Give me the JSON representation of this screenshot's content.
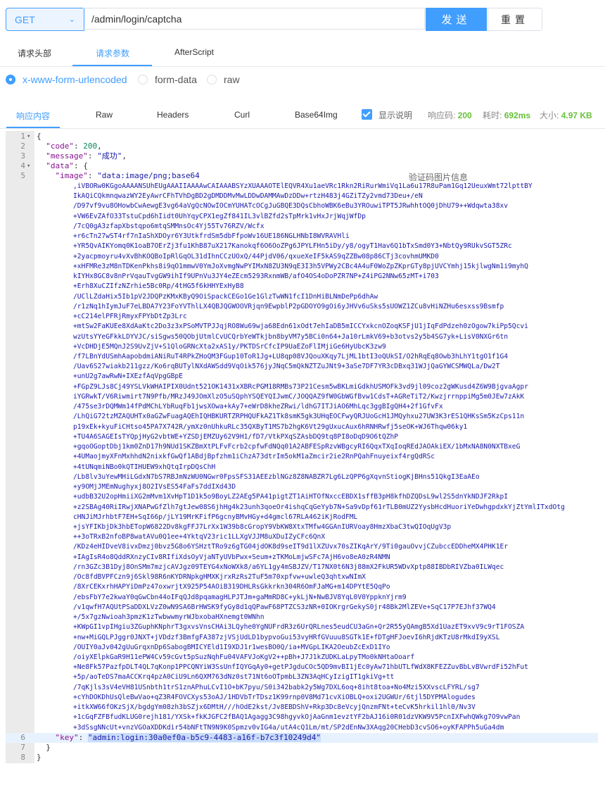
{
  "request": {
    "method": "GET",
    "url": "/admin/login/captcha",
    "send_label": "发送",
    "reset_label": "重置"
  },
  "request_tabs": [
    "请求头部",
    "请求参数",
    "AfterScript"
  ],
  "body_types": [
    "x-www-form-urlencoded",
    "form-data",
    "raw"
  ],
  "response_tabs": [
    "响应内容",
    "Raw",
    "Headers",
    "Curl",
    "Base64Img"
  ],
  "response_meta": {
    "show_desc_label": "显示说明",
    "code_label": "响应码:",
    "code_value": "200",
    "time_label": "耗时:",
    "time_value": "692ms",
    "size_label": "大小:",
    "size_value": "4.97 KB"
  },
  "code": {
    "line_numbers": [
      "1",
      "2",
      "3",
      "4",
      "5",
      "6",
      "7",
      "8"
    ],
    "open_brace": "{",
    "code_key": "\"code\"",
    "code_value": "200",
    "message_key": "\"message\"",
    "message_value": "\"成功\"",
    "data_key": "\"data\"",
    "image_key": "\"image\"",
    "image_value_start": "\"data:image/png;base64",
    "image_tooltip": "验证码图片信息",
    "key_key": "\"key\"",
    "key_value": "\"admin:login:30a0ef0a-b5c9-4483-a16f-b7c3f10249d4\"",
    "close_data": "}",
    "close_root": "}",
    "image_lines": [
      ",iVBORw0KGgoAAAANSUhEUgAAAIIAAAAwCAIAAABSYzXUAAAOTElEQVR4Xu1aeVRc1Rkn2RiRurWmiVq1La6u17R8uPam1Gq12UeuxWmt72lpttBY",
      "IkAQiCQkmnqwazWY2EyAwrCFhTVhDgBD2gDMDDMvMwLDDwDAMMAwDzDDw+rtzH483j4GZiTZy2vmd73Deu+/eN",
      "/D97vf9vu8OHowbCwAewgE3vg64aVgQcNOwIOCmYUHATcOCgJuGBQE3DQsCbhoWBK6eBu3YROuwiTPT5JRwhhtOQ0jDhU79++Wdqwta38xv",
      "+VW6EvZAfO33TstuCpd6hIidt0UhYqyCPX1egZf841IL3vlBZfd2sTpMrk1vHxJrjWqjWfDp",
      "/7cQ0gA3zfapXbstqpo6mtqSMMnsOc4Yj55Tv76RZV/Wcfx",
      "+r6cTn27wST4rf7nIaShXDOyr6Y3UtkfrdSm5dbFfpoWv16UE186NGLHNbI8WVRAVHli",
      "+YR5QvAIKYomq0K1oaB7OErZj3fu1KhB87uX217Kanokqf6O6OoZPg6JPYLFHn5iDy/y8/ogyT1Hav6Q1bTxSmd0Y3+NbtQy9RUkvSGT5ZRc",
      "+2yacpmoyru4vXvBhKOQBoIpRlGqOL31dIhnCCzUOxQ/44PjdV06/qxueXeIF5kAS9qZZBw08p86CTj3covhmUMKD0",
      "+xHFMRe3zM8nTDKenPkhs8i9qO1mmwV0YmJoXvmgNwPYIMxN8ZU3N9qE3I3h5VPWy2CBc4A4uF0WoZpZKprGTy8pjUVCYmhj15kjlwgNm1i9myhQ",
      "kIYHx8GC8v8nPrVqauTvgGW9ihIf9UPnVu3JY4eZEcm5293RxnmWB/afO4OS4oDoPZR7NP+Z4iPG2NNw65zMT+i703",
      "+Erh8XuCZIfzNZrhie5Bc0Rp/4tHG5f6kHHYExHyB8",
      "/UClLZdaHix5Ib1pV2JDQPzKMxKByQ9OiSpackCEGo1Ge1GlzTwWN1fcI1DnHiBLNmDePp6dhAw",
      "/r1zNq1hIymJuF7eLBDA7Y23FoYVThlLX4QBJQGWOOVRjqn9EwpblP2pGDOYO9gOi6yJHVv6uSks5sUOWZ1ZCu8vHiNZHu6esxss9Bsmfp",
      "+cC214elPFRjRmyxFPYbDtZp3Lrc",
      "+mtSw2FaKUEe8XdAaKtc2Do3z3xPSoMVTPJJqjRO8Wu69wja68Edn61xOdt7ehIaDB5mICCYxkcnOZoqKSFjU1jIqFdPdzeh0zOgow7kiPp5Qcvi",
      "wzUtsYYeGFkkLDYVJC/siSgws50QObjUtmlCvUCQrbYeWTkjbn8byVM7y5BCi0n64+Ja10rLmkV69+b3otvs2y5b4SG7yk+LisV0NXGr6tn",
      "+VcDHDjE5MQnJ2S9UvZjV+S1QloGRNcXta2xAS1y/PKTDSrCfcIP9UaEZoFlIMjiGe6HyUbcK3zw9",
      "/f7LBnYdUSmhAapobdmiANiRuT4RPkZHoQM3FGup10ToR1Jg+LU8qp08VJQouXKqy7LjML1btI3oQUkSI/O2hRqEq8Owb3hLhY1tgO1f1G4",
      "/Uav6S27wiakb211gzz/Ko6rqBUTylNXdAWSdd9VqOik576jyJNqC5mQkNZTZuJNt9+3aSe7DF7YR3cDBxq31WJjQaGYWCSMWQLa/Dw2T",
      "+unU2g7awRwN+IXEzfAqVpgGBpE",
      "+FGpZ9LJs8Cj49YSLVkWHAIPIX0Udnt521OK1431xXBRcPGM18RMBs73P21Cesm5wBKLmiGdkhUSMOFk3vd9jl09coz2gWKusd4Z6W9BjgvaAgpr",
      "iYGRwkT/V6Riwmirt7N9Pfb/MRzJ49JOmXlzO5uSQphYSQEYQIJwmC/JOQQAZ9fW0GbWGfBvw1CdsT+AGReTiT2/KwzjrrnppiMg5m0JEw7zAkK",
      "/475se3rDQMWm14fPdMChLYbRuqFb1jwsXOwa+kAy7+eWrD8kheZRwi/ldhG7ITJiAO6MhLqc3ggBIgQH4+2f1GfvFx",
      "/LhQiG72tzMZAQUHTx0aGZwFuagAQEhIQHBKURTZRPHQUFkAZ1Tk8smK5gk3UHqEOCFwyQRJUoGcH1JMQyhxu27UW3K3rES1QHKsSm5KzCps11n",
      "p19xEk+kyuFiCHtso45PA7X742R/ymXz0nUhkuRLc35QXByT1MS7b2hgK6Vt29gUxucAux6hRNHRwfj5seOK+WJ6Thqw06ky1",
      "+TU4A6SAGEIsTYQpjHyG2vbtWE+YZSDjEMZUy62V9H1/fD7/VtkPXqSZAsbDQ9tq8PI8oDqD9O6tQZhP",
      "+gqoOGoptDbj1km0ZnD17h9NUd1SKZBmXtPLFvFcrb2cpfwFdNQq01A2ABFESpRzvWBgcyRI6QqxTXqIoqREdJAOAkiEX/1bMxNA8N0NXTBxeG",
      "+4UMaojmyXFnMxhhdN2nixkfGwQf1ABdjBpfzhm1iChzA73dtrIm5okM1aZmcir2ie2RnPQahFnuyeixf4rgQdRSc",
      "+4tUNqmiNBo0kQTIHUEW9xhQtqIrpDQsChH",
      "/Lb8lv3uYewMHiLGdxN7bS7RBJmNzWU0NGwr0FpsSFS31AEEzblNGz8Z8NABZR7Lg6LzQPP6gXqvnStiogKjBHns51QkgI3EaAEo",
      "+y9OMjJMEmNughyxj8O2IVsES54FaFs7ddIXd43D",
      "+udbB32U2opHmiiXG2mMvm1XvHpT1D1k5o9BoyLZ2AEg5PA41pigtZT1AiHTOfNxccEBDX1sffB3pH8kfhDZQDsL9wl2S5dnYkNDJF2RkpI",
      "+z2SBAg40RiIRwjXNAPwGfZlh7gtJew08S6jhHg4k23unh3qoeOr4ishqCqGeYyb7N+Sa9vDpf61rTLB0mUZ2YysbHcdHuoriYeDwhgpdxkYjZtYmlITxdOtg",
      "cHNJiMJrhbtF7EH+SqI66p/jLY19MrKFifP6gcnyBMvHGy+d4gmcl67RLA462iKjRodFML",
      "+jsYFIKbjDk3hbETopW6822Dv8kgFFJ7LrXx1W39b8cGropY9VbKW8XtxTMfw4GGAnIURVoay8HmzXbaC3twQIOqUgV3p",
      "++3oTRxB2nfoBP8watAVu0Q1ee+4YktqV23ric1LLXgVJJM8uXDuIZyCFc6QnX",
      "/KDz4eHIDveV8ivxDmzj0bvz5G8o6YSHztTRo9z6gTG04jdOK8d9seIT9d1lXZUvx70sZIKqArY/9Ti0gauOvvjCZubccEDDheMX4PHK1Er",
      "+IAgIsR4o8QddRXnzyCIv8RIfiXdsOyVjaNTyUVbPwx+Seum+zTKMoLmjwSFc7AjH6vo8eA0zR4NMN",
      "/rn3GZc3B1Dyj8OnSMm7mzjcAVJgz09TEYG4xNoWXk8/a6YL1gy4mSBJZV/T17NX0t6N3j88mX2FkUR5WDvXptp88IBDbRIVZba0ILWqec",
      "/Oc8fdBVPFCzn9j6Skl98R6nKYDRNpkgHMXKjrxRzRs2TuF5m70xpfvw+uwleQ3qhtxwNImX",
      "/8XrCEKxrhHAPYiDmPz47oxwrjtX925P54AOiB319DHLRsGkkrkn304R6OmFJaMG+m14DPYtE5QqPo",
      "/ebsFbY7e2kwaY0qGwCbn44oIFqQJd8pqamagHLPJTJm+gaMmRD8C+ykLjN+NwBJV8YqL0V0YppknYjrm9",
      "/v1qwfH7AQUtPSaDDXLVzZ0wN9SA6BrHWSK9fyGy8d1qQPawF68PTZCS3zNR+0IOKrgrGekyS0jr48Bk2MlZEVe+SqC17P7EJhf37WQ4",
      "+/5x7gzNwioah3pmzK1zTwbwwmyrWJbxobaHXnemgt0WNhn",
      "+KWpGI1vpIHgiu3ZGuphKNphrT3gxvsVnsCHAi3LQyhe0YgNUFrdR3z6UrQRLnes5eudCU3aGn+Qr2R55yQAmgB5Xd1UazET9xvV9c9rT1FOSZA",
      "+nw+MiGQLPJggr0JNXT+jVDdzf3BmfgFA387zjVSjUdLD1bypvoGui53vyHRfGVuuu8SGTk1E+fDTgHFJoevI6hRjdKTzU8rMkdI9yXSL",
      "/OUIY0aJv042gUuGrqxnDp6SabogBMICYEld1I9XDJ1r1wesBO0Q/ia+MVGpLIKA2OeubZcExD1IYo",
      "/oiyXElpkGaR9H11ePW4Cv59cGvt5pSuzNqhFu04VAFVJoKgV2++pBh+J7J1kZUDKLaLpyTMo0kNHtaOoarf",
      "+Ne8Fk57PazfpDLT4QL7qKonp1PPCQNYiW3SsUnfIQYGqAy0+getPJgduCOc5QD9mvBI1jEc0yAw71hbUTLfWdX8KFEZZuvBbLvBVwrdFi52hFut",
      "+5p/aoTeDS7maACCKrq4pzA0CiU9Ln6QXM763dNz0st71Nt6oOTpmbL3ZN3AqHCyIzigIT1gkiVg+tt",
      "/7qKjls3sV4eVH81USnbth1trS1znAPhuLCvI1O+bK7pyu/S0i342babk2y5Wg7DXL6oq+8iht8toa+No4Mzi5XXvscLFYRL/sg7",
      "+cYhDOKDhUsQleBwVao+qZ3R4FOVCXys53oAJ/1HDVbTrTDsz1K99rnp0V8Md71cvXiOBLQ+oxi2UGWUr/6tjl5DYPMAlogudes",
      "+itkXW66fOKzSjX/bgdgYm08zh3bSZjx6DMtH///hOdE2kst/Jv8EBDShV+Rkp3Dc8eVcyjQnzmFNt+teCvK5hrkil1hl0/Nv3V",
      "+1cGqFZFBfudKLUG0rejh181/YXSk+fkKJGFC2fBAQ1Agagg3C98hgyvkOjAaGnm1evztYF2bAJ16i0R01dzVKW9V5PcnIXFwhQWkg7O9vwPan",
      "+3dSsgNNcUt+vnzVGOaXDDKdir54bNFtTN9N9K0Spmzv0vIG4a/utA4cQ1Lm/mt/SP2dEnNw3XAqg20CHebD3cvSO6+oyKFAPPh5uGa4dm",
      "/fjz6aR9gb2R28zPYm4arjXC5Nploip0LfxBNw1fA9RGs6ArctOwIOCmYUHATcOCgJuGBYH/AKeRUCp4+PdnAAAAAElFTkSuQmCC\","
    ]
  }
}
